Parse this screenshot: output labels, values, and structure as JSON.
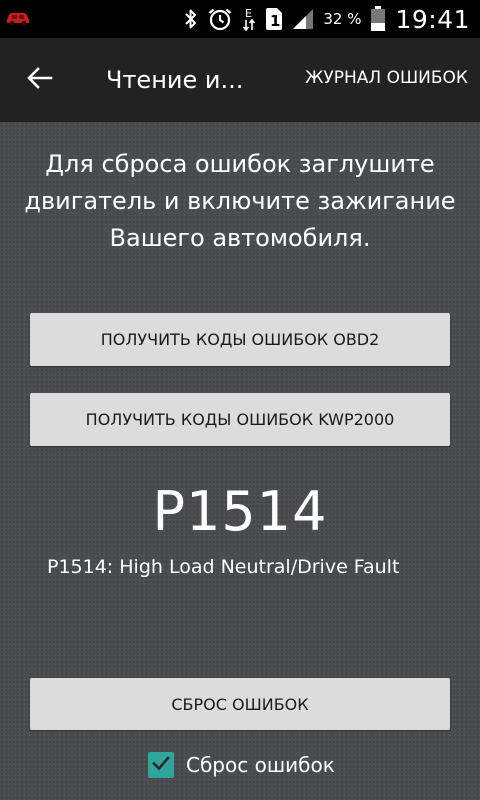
{
  "status_bar": {
    "notification_icon": "car-icon",
    "icons": [
      "bluetooth-icon",
      "alarm-icon",
      "data-e-icon",
      "sim-1-icon",
      "signal-icon"
    ],
    "battery_percent": "32 %",
    "time": "19:41"
  },
  "action_bar": {
    "back_icon": "arrow-back-icon",
    "title": "Чтение и...",
    "journal_label": "ЖУРНАЛ ОШИБОК"
  },
  "main": {
    "instruction": "Для сброса ошибок заглушите двигатель и включите зажигание Вашего автомобиля.",
    "get_obd2_label": "ПОЛУЧИТЬ КОДЫ ОШИБОК OBD2",
    "get_kwp2000_label": "ПОЛУЧИТЬ КОДЫ ОШИБОК KWP2000",
    "error_code": "P1514",
    "error_description": "P1514: High Load Neutral/Drive Fault",
    "reset_button_label": "СБРОС ОШИБОК",
    "reset_checkbox_label": "Сброс ошибок",
    "reset_checkbox_checked": true
  },
  "colors": {
    "background": "#4a4d50",
    "action_bar": "#222222",
    "status_bar": "#000000",
    "button": "#dcdcdc",
    "checkbox_accent": "#2fa59b",
    "car_icon": "#c4201e"
  }
}
